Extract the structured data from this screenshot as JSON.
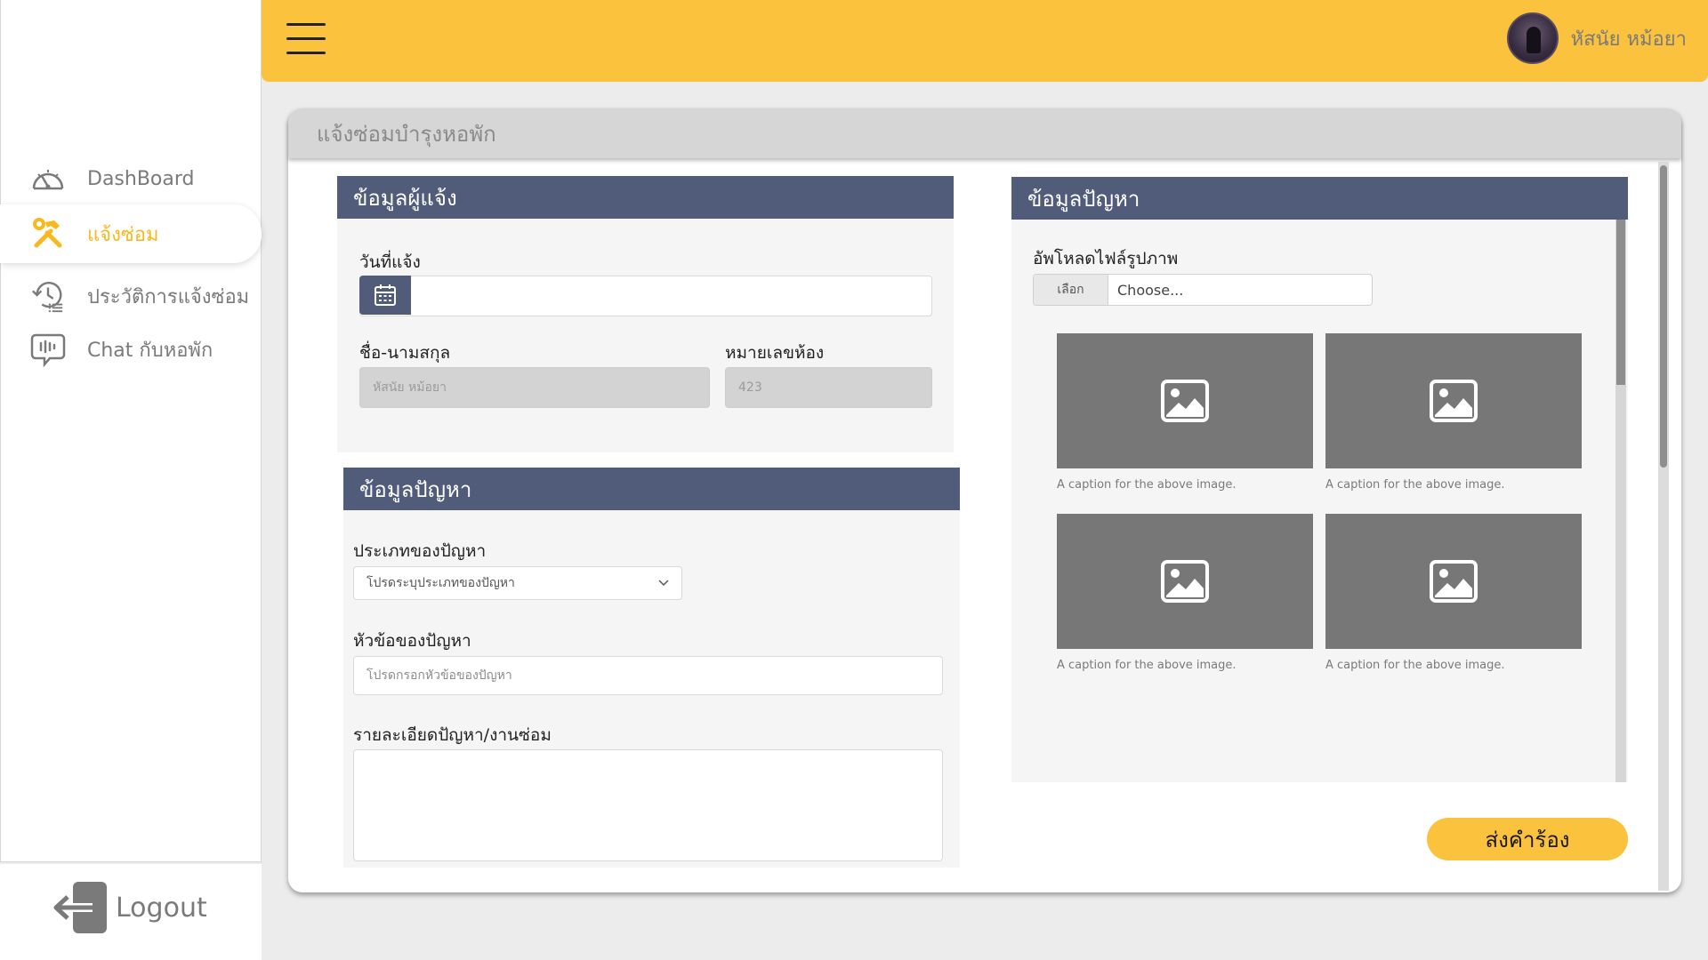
{
  "sidebar": {
    "items": [
      {
        "label": "DashBoard",
        "icon": "speedometer-icon"
      },
      {
        "label": "แจ้งซ่อม",
        "icon": "hammer-wrench-icon"
      },
      {
        "label": "ประวัติการแจ้งซ่อม",
        "icon": "history-icon"
      },
      {
        "label": "Chat กับหอพัก",
        "icon": "chat-icon"
      }
    ],
    "active_item": "แจ้งซ่อม",
    "logout_label": "Logout"
  },
  "header": {
    "user_name": "หัสนัย หม้อยา"
  },
  "page": {
    "title": "แจ้งซ่อมบำรุงหอพัก"
  },
  "reporter_panel": {
    "heading": "ข้อมูลผู้แจ้ง",
    "date_label": "วันที่แจ้ง",
    "date_value": "",
    "name_label": "ชื่อ-นามสกุล",
    "name_value": "หัสนัย หม้อยา",
    "room_label": "หมายเลขห้อง",
    "room_value": "423"
  },
  "problem_panel": {
    "heading": "ข้อมูลปัญหา",
    "type_label": "ประเภทของปัญหา",
    "type_placeholder": "โปรดระบุประเภทของปัญหา",
    "topic_label": "หัวข้อของปัญหา",
    "topic_placeholder": "โปรดกรอกหัวข้อของปัญหา",
    "detail_label": "รายละเอียดปัญหา/งานซ่อม",
    "detail_value": ""
  },
  "image_panel": {
    "heading": "ข้อมูลปัญหา",
    "upload_label": "อัพโหลดไฟล์รูปภาพ",
    "upload_button": "เลือก",
    "upload_text": "Choose...",
    "images": [
      {
        "caption": "A caption for the above image."
      },
      {
        "caption": "A caption for the above image."
      },
      {
        "caption": "A caption for the above image."
      },
      {
        "caption": "A caption for the above image."
      }
    ]
  },
  "submit_label": "ส่งคำร้อง",
  "colors": {
    "accent": "#fbc23e",
    "panel_header": "#515b7a",
    "active_nav": "#f8b91f",
    "placeholder_image": "#777777"
  }
}
